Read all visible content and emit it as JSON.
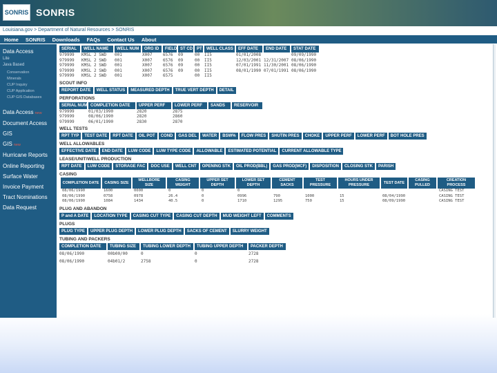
{
  "header": {
    "logo_text": "SONRIS",
    "app_title": "SONRIS",
    "breadcrumb": "Louisiana.gov > Department of Natural Resources > SONRIS"
  },
  "topnav": [
    "Home",
    "SONRIS",
    "Downloads",
    "FAQs",
    "Contact Us",
    "About"
  ],
  "sidebar": {
    "data_access": "Data Access",
    "sub": [
      "Lite",
      "Java Based"
    ],
    "sub2": [
      "Conservation",
      "Minerals",
      "CUP Inquiry",
      "CUP Application",
      "CUP GIS Databases"
    ],
    "items": [
      "Data Access",
      "Document Access",
      "GIS",
      "GIS",
      "Hurricane Reports",
      "Online Reporting",
      "Surface Water",
      "Invoice Payment",
      "Tract Nominations",
      "Data Request"
    ],
    "new_label": "new"
  },
  "well_header": {
    "columns": [
      "SERIAL",
      "WELL NAME",
      "WELL NUM",
      "ORG ID",
      "FIELD",
      "ST CD",
      "PT",
      "WELL CLASS",
      "EFF DATE",
      "END DATE",
      "STAT DATE"
    ],
    "rows": [
      [
        "979999",
        "KMSL 2 SWD",
        "001",
        "X007",
        "6576",
        "09",
        "00",
        "II5",
        "01/01/2008",
        "",
        "09/09/1990"
      ],
      [
        "979999",
        "KMSL 2 SWD",
        "001",
        "X007",
        "6576",
        "09",
        "00",
        "II5",
        "12/03/2001",
        "12/31/2007",
        "08/06/1990"
      ],
      [
        "979999",
        "KMSL 2 SWD",
        "001",
        "X007",
        "6576",
        "09",
        "00",
        "II5",
        "07/01/1991",
        "11/30/2001",
        "08/06/1990"
      ],
      [
        "979999",
        "KMSL 2 SWD",
        "001",
        "X007",
        "6576",
        "09",
        "00",
        "II5",
        "08/01/1990",
        "07/01/1991",
        "08/06/1990"
      ],
      [
        "979999",
        "KMSL 2 SWD",
        "001",
        "X007",
        "6575",
        "",
        "00",
        "II5",
        "",
        "",
        ""
      ]
    ]
  },
  "scout_info": {
    "title": "SCOUT INFO",
    "columns": [
      "REPORT DATE",
      "WELL STATUS",
      "MEASURED DEPTH",
      "TRUE VERT DEPTH",
      "DETAIL"
    ]
  },
  "perforations": {
    "title": "PERFORATIONS",
    "columns": [
      "SERIAL NUM",
      "COMPLETION DATE",
      "UPPER PERF",
      "LOWER PERF",
      "SANDS",
      "RESERVOIR"
    ],
    "rows": [
      [
        "979999",
        "01/03/1990",
        "2820",
        "2875",
        "",
        ""
      ],
      [
        "979999",
        "08/06/1990",
        "2820",
        "2860",
        "",
        ""
      ],
      [
        "979999",
        "06/01/1990",
        "2830",
        "2870",
        "",
        ""
      ]
    ]
  },
  "well_tests": {
    "title": "WELL TESTS",
    "columns": [
      "RPT TYP",
      "TEST DATE",
      "RPT DATE",
      "OIL POT",
      "COND",
      "GAS DEL",
      "WATER",
      "BSW%",
      "FLOW PRES",
      "SHUTIN PRES",
      "CHOKE",
      "UPPER PERF",
      "LOWER PERF",
      "BOT HOLE PRES"
    ]
  },
  "allowables": {
    "title": "WELL ALLOWABLES",
    "columns": [
      "EFFECTIVE DATE",
      "END DATE",
      "LUW CODE",
      "LUW TYPE CODE",
      "ALLOWABLE",
      "ESTIMATED POTENTIAL",
      "CURRENT ALLOWABLE TYPE"
    ]
  },
  "lease": {
    "title": "LEASE/UNIT/WELL PRODUCTION",
    "columns": [
      "RPT DATE",
      "LUW CODE",
      "STORAGE FAC",
      "DOC USE",
      "WELL CNT",
      "OPENING STK",
      "OIL PROD(BBL)",
      "GAS PROD(MCF)",
      "DISPOSITION",
      "CLOSING STK",
      "PARISH"
    ]
  },
  "casing": {
    "title": "CASING",
    "columns": [
      "COMPLETION DATE",
      "CASING SIZE",
      "WELLBORE SIZE",
      "CASING WEIGHT",
      "UPPER SET DEPTH",
      "LOWER SET DEPTH",
      "CEMENT SACKS",
      "TEST PRESSURE",
      "HOURS UNDER PRESSURE",
      "TEST DATE",
      "CASING PULLED",
      "CREATION PROCESS"
    ],
    "rows": [
      [
        "08/06/1990",
        "1600",
        "0000",
        "0",
        "0",
        "0",
        "",
        "",
        "",
        "",
        "",
        "CASING TEST"
      ],
      [
        "08/06/1990",
        "0758",
        "0978",
        "26.4",
        "0",
        "0996",
        "790",
        "1000",
        "15",
        "08/04/1990",
        "",
        "CASING TEST"
      ],
      [
        "08/06/1990",
        "1084",
        "1434",
        "40.5",
        "0",
        "1710",
        "1295",
        "750",
        "15",
        "08/09/1990",
        "",
        "CASING TEST"
      ]
    ]
  },
  "plug": {
    "title": "PLUG AND ABANDON",
    "columns": [
      "P and A DATE",
      "LOCATION TYPE",
      "CASING CUT TYPE",
      "CASING CUT DEPTH",
      "MUD WEIGHT LEFT",
      "COMMENTS"
    ]
  },
  "plugs": {
    "title": "PLUGS",
    "columns": [
      "PLUG TYPE",
      "UPPER PLUG DEPTH",
      "LOWER PLUG DEPTH",
      "SACKS OF CEMENT",
      "SLURRY WEIGHT"
    ]
  },
  "tubing": {
    "title": "TUBING AND PACKERS",
    "columns": [
      "COMPLETION DATE",
      "TUBING SIZE",
      "TUBING LOWER DEPTH",
      "TUBING UPPER DEPTH",
      "PACKER DEPTH"
    ],
    "rows": [
      [
        "08/06/1990",
        "00b00/00",
        "0",
        "0",
        "2728"
      ],
      [
        "08/06/1990",
        "04b01/2",
        "2758",
        "0",
        "2728"
      ]
    ]
  }
}
